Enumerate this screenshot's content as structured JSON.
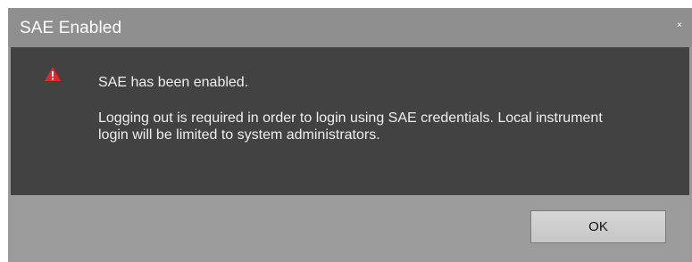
{
  "dialog": {
    "title": "SAE Enabled",
    "close_glyph": "×",
    "icon": "warning-icon",
    "message_title": "SAE has been enabled.",
    "message_body": "Logging out is required in order to login using SAE credentials. Local instrument login will be limited to system administrators.",
    "ok_label": "OK"
  },
  "colors": {
    "titlebar": "#8f8f8f",
    "body": "#424242",
    "footer": "#9c9c9c",
    "warning": "#e2262b"
  }
}
